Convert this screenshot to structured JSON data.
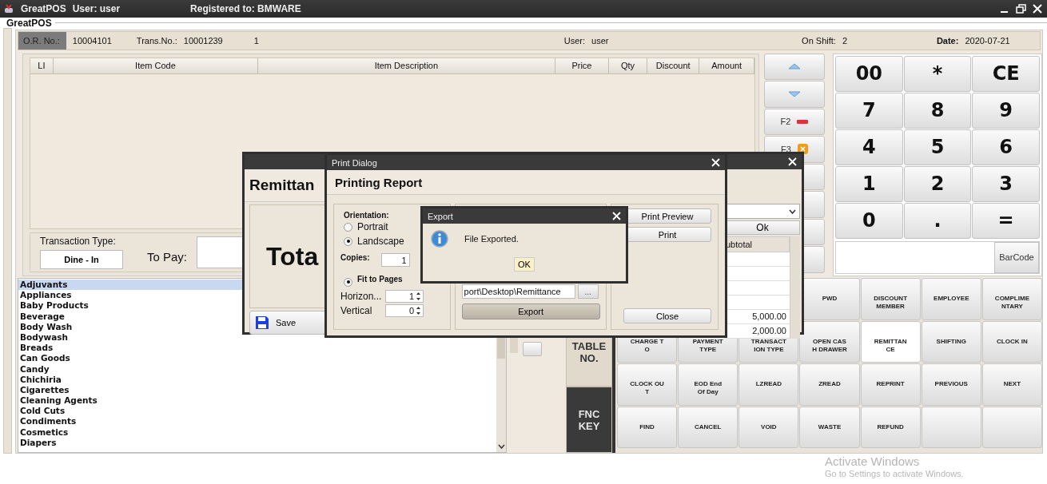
{
  "window": {
    "title": "GreatPOS",
    "user": "User: user",
    "registered": "Registered to: BMWARE"
  },
  "group_label": "GreatPOS",
  "header": {
    "or_label": "O.R. No.:",
    "or_value": "10004101",
    "trans_label": "Trans.No.:",
    "trans_value": "10001239",
    "count": "1",
    "user_label": "User:",
    "user_value": "user",
    "shift_label": "On Shift:",
    "shift_value": "2",
    "date_label": "Date:",
    "date_value": "2020-07-21"
  },
  "items_table": {
    "columns": [
      "LI",
      "Item Code",
      "Item Description",
      "Price",
      "Qty",
      "Discount",
      "Amount"
    ]
  },
  "transaction": {
    "type_label": "Transaction Type:",
    "type_value": "Dine - In",
    "to_pay_label": "To Pay:"
  },
  "nav_buttons": [
    {
      "kind": "up"
    },
    {
      "kind": "down"
    },
    {
      "kind": "minus",
      "label": "F2"
    },
    {
      "kind": "cross",
      "label": "F3"
    },
    {
      "kind": "blank"
    },
    {
      "kind": "blank"
    },
    {
      "kind": "blank"
    },
    {
      "kind": "blank"
    }
  ],
  "keypad": [
    "00",
    "*",
    "CE",
    "7",
    "8",
    "9",
    "4",
    "5",
    "6",
    "1",
    "2",
    "3",
    "0",
    ".",
    "="
  ],
  "barcode_button": "BarCode",
  "categories": [
    {
      "label": "Adjuvants",
      "selected": true
    },
    {
      "label": "Appliances",
      "selected": false
    },
    {
      "label": "Baby Products",
      "selected": false
    },
    {
      "label": "Beverage",
      "selected": false
    },
    {
      "label": "Body Wash",
      "selected": false
    },
    {
      "label": "Bodywash",
      "selected": false
    },
    {
      "label": "Breads",
      "selected": false
    },
    {
      "label": "Can Goods",
      "selected": false
    },
    {
      "label": "Candy",
      "selected": false
    },
    {
      "label": "Chichiria",
      "selected": false
    },
    {
      "label": "Cigarettes",
      "selected": false
    },
    {
      "label": "Cleaning Agents",
      "selected": false
    },
    {
      "label": "Cold Cuts",
      "selected": false
    },
    {
      "label": "Condiments",
      "selected": false
    },
    {
      "label": "Cosmetics",
      "selected": false
    },
    {
      "label": "Diapers",
      "selected": false
    }
  ],
  "side_tabs": [
    {
      "label": "TABLE NO.",
      "selected": false
    },
    {
      "label": "FNC KEY",
      "selected": true
    }
  ],
  "function_keys": [
    [
      {
        "kind": "key",
        "lines": [
          "PWD"
        ],
        "selected": false
      },
      {
        "kind": "key",
        "lines": [
          "DISCOUNT",
          "MEMBER"
        ],
        "selected": false
      },
      {
        "kind": "key",
        "lines": [
          "EMPLOYEE"
        ],
        "selected": false
      },
      {
        "kind": "key",
        "lines": [
          "COMPLIME",
          "NTARY"
        ],
        "selected": false
      }
    ],
    [
      {
        "kind": "key",
        "lines": [
          "CHARGE T",
          "O"
        ],
        "selected": false
      },
      {
        "kind": "key",
        "lines": [
          "PAYMENT",
          "TYPE"
        ],
        "selected": false
      },
      {
        "kind": "key",
        "lines": [
          "TRANSACT",
          "ION TYPE"
        ],
        "selected": false
      },
      {
        "kind": "key",
        "lines": [
          "OPEN CAS",
          "H DRAWER"
        ],
        "selected": false
      },
      {
        "kind": "key",
        "lines": [
          "REMITTAN",
          "CE"
        ],
        "selected": true
      },
      {
        "kind": "key",
        "lines": [
          "SHIFTING"
        ],
        "selected": false
      },
      {
        "kind": "key",
        "lines": [
          "CLOCK IN"
        ],
        "selected": false
      }
    ],
    [
      {
        "kind": "key",
        "lines": [
          "CLOCK OU",
          "T"
        ],
        "selected": false
      },
      {
        "kind": "key",
        "lines": [
          "EOD End",
          "Of Day"
        ],
        "selected": false
      },
      {
        "kind": "key",
        "lines": [
          "LZREAD"
        ],
        "selected": false
      },
      {
        "kind": "key",
        "lines": [
          "ZREAD"
        ],
        "selected": false
      },
      {
        "kind": "key",
        "lines": [
          "REPRINT"
        ],
        "selected": false
      },
      {
        "kind": "key",
        "lines": [
          "PREVIOUS"
        ],
        "selected": false
      },
      {
        "kind": "key",
        "lines": [
          "NEXT"
        ],
        "selected": false
      }
    ],
    [
      {
        "kind": "key",
        "lines": [
          "FIND"
        ],
        "selected": false
      },
      {
        "kind": "key",
        "lines": [
          "CANCEL"
        ],
        "selected": false
      },
      {
        "kind": "key",
        "lines": [
          "VOID"
        ],
        "selected": false
      },
      {
        "kind": "key",
        "lines": [
          "WASTE"
        ],
        "selected": false
      },
      {
        "kind": "key",
        "lines": [
          "REFUND"
        ],
        "selected": false
      },
      {
        "kind": "blank"
      },
      {
        "kind": "blank"
      }
    ]
  ],
  "remittance_dialog": {
    "title": "Remittan",
    "total": "Tota",
    "save": "Save",
    "ok": "Ok",
    "column": "ubtotal",
    "values": [
      "5,000.00",
      "2,000.00"
    ]
  },
  "print_dialog": {
    "title": "Print Dialog",
    "heading": "Printing Report",
    "orientation_label": "Orientation:",
    "orientations": [
      {
        "label": "Portrait",
        "selected": false
      },
      {
        "label": "Landscape",
        "selected": true
      }
    ],
    "copies_label": "Copies:",
    "copies": "1",
    "fit": {
      "label": "Fit to Pages",
      "selected": true
    },
    "horizontal_label": "Horizon...",
    "horizontal": "1",
    "vertical_label": "Vertical",
    "vertical": "0",
    "path": "port\\Desktop\\Remittance",
    "browse": "...",
    "export": "Export",
    "print_preview": "Print Preview",
    "print": "Print",
    "close": "Close"
  },
  "export_dialog": {
    "title": "Export",
    "message": "File Exported.",
    "ok": "OK"
  },
  "os_notice": {
    "title": "Activate Windows",
    "subtitle": "Go to Settings to activate Windows."
  }
}
